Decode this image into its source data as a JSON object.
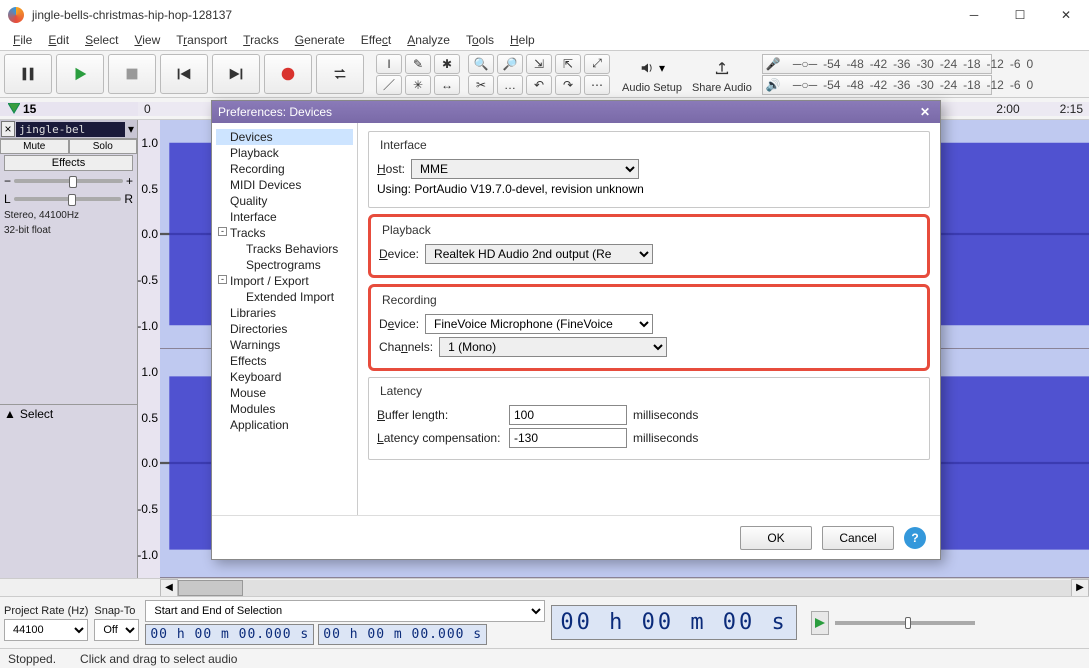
{
  "window": {
    "title": "jingle-bells-christmas-hip-hop-128137"
  },
  "menu": [
    "File",
    "Edit",
    "Select",
    "View",
    "Transport",
    "Tracks",
    "Generate",
    "Effect",
    "Analyze",
    "Tools",
    "Help"
  ],
  "audio_setup_label": "Audio Setup",
  "share_audio_label": "Share Audio",
  "meter_ticks": [
    "-54",
    "-48",
    "-42",
    "-36",
    "-30",
    "-24",
    "-18",
    "-12",
    "-6",
    "0"
  ],
  "timeline": {
    "marker": "15",
    "vis_ticks": [
      "0",
      "2:00",
      "2:15"
    ]
  },
  "track": {
    "name": "jingle-bel",
    "mute": "Mute",
    "solo": "Solo",
    "effects": "Effects",
    "info1": "Stereo, 44100Hz",
    "info2": "32-bit float",
    "select_label": "Select",
    "scale": [
      "1.0",
      "0.5",
      "0.0",
      "-0.5",
      "-1.0",
      "1.0",
      "0.5",
      "0.0",
      "-0.5",
      "-1.0"
    ]
  },
  "selectionbar": {
    "project_rate_label": "Project Rate (Hz)",
    "project_rate_value": "44100",
    "snap_label": "Snap-To",
    "snap_value": "Off",
    "sel_mode": "Start and End of Selection",
    "tc1": "00 h 00 m 00.000 s",
    "tc2": "00 h 00 m 00.000 s",
    "bigtc": "00 h 00 m 00 s"
  },
  "status": {
    "left": "Stopped.",
    "right": "Click and drag to select audio"
  },
  "dialog": {
    "title": "Preferences: Devices",
    "tree": [
      {
        "label": "Devices",
        "lv": 1,
        "sel": true
      },
      {
        "label": "Playback",
        "lv": 1
      },
      {
        "label": "Recording",
        "lv": 1
      },
      {
        "label": "MIDI Devices",
        "lv": 1
      },
      {
        "label": "Quality",
        "lv": 1
      },
      {
        "label": "Interface",
        "lv": 1
      },
      {
        "label": "Tracks",
        "lv": 1,
        "exp": "-"
      },
      {
        "label": "Tracks Behaviors",
        "lv": 2
      },
      {
        "label": "Spectrograms",
        "lv": 2
      },
      {
        "label": "Import / Export",
        "lv": 1,
        "exp": "-"
      },
      {
        "label": "Extended Import",
        "lv": 2
      },
      {
        "label": "Libraries",
        "lv": 1
      },
      {
        "label": "Directories",
        "lv": 1
      },
      {
        "label": "Warnings",
        "lv": 1
      },
      {
        "label": "Effects",
        "lv": 1
      },
      {
        "label": "Keyboard",
        "lv": 1
      },
      {
        "label": "Mouse",
        "lv": 1
      },
      {
        "label": "Modules",
        "lv": 1
      },
      {
        "label": "Application",
        "lv": 1
      }
    ],
    "interface": {
      "legend": "Interface",
      "host_label": "Host:",
      "host_value": "MME",
      "using": "Using: PortAudio V19.7.0-devel, revision unknown"
    },
    "playback": {
      "legend": "Playback",
      "device_label": "Device:",
      "device_value": "Realtek HD Audio 2nd output (Re"
    },
    "recording": {
      "legend": "Recording",
      "device_label": "Device:",
      "device_value": "FineVoice Microphone (FineVoice",
      "channels_label": "Channels:",
      "channels_value": "1 (Mono)"
    },
    "latency": {
      "legend": "Latency",
      "buffer_label": "Buffer length:",
      "buffer_value": "100",
      "buffer_unit": "milliseconds",
      "comp_label": "Latency compensation:",
      "comp_value": "-130",
      "comp_unit": "milliseconds"
    },
    "ok": "OK",
    "cancel": "Cancel"
  }
}
